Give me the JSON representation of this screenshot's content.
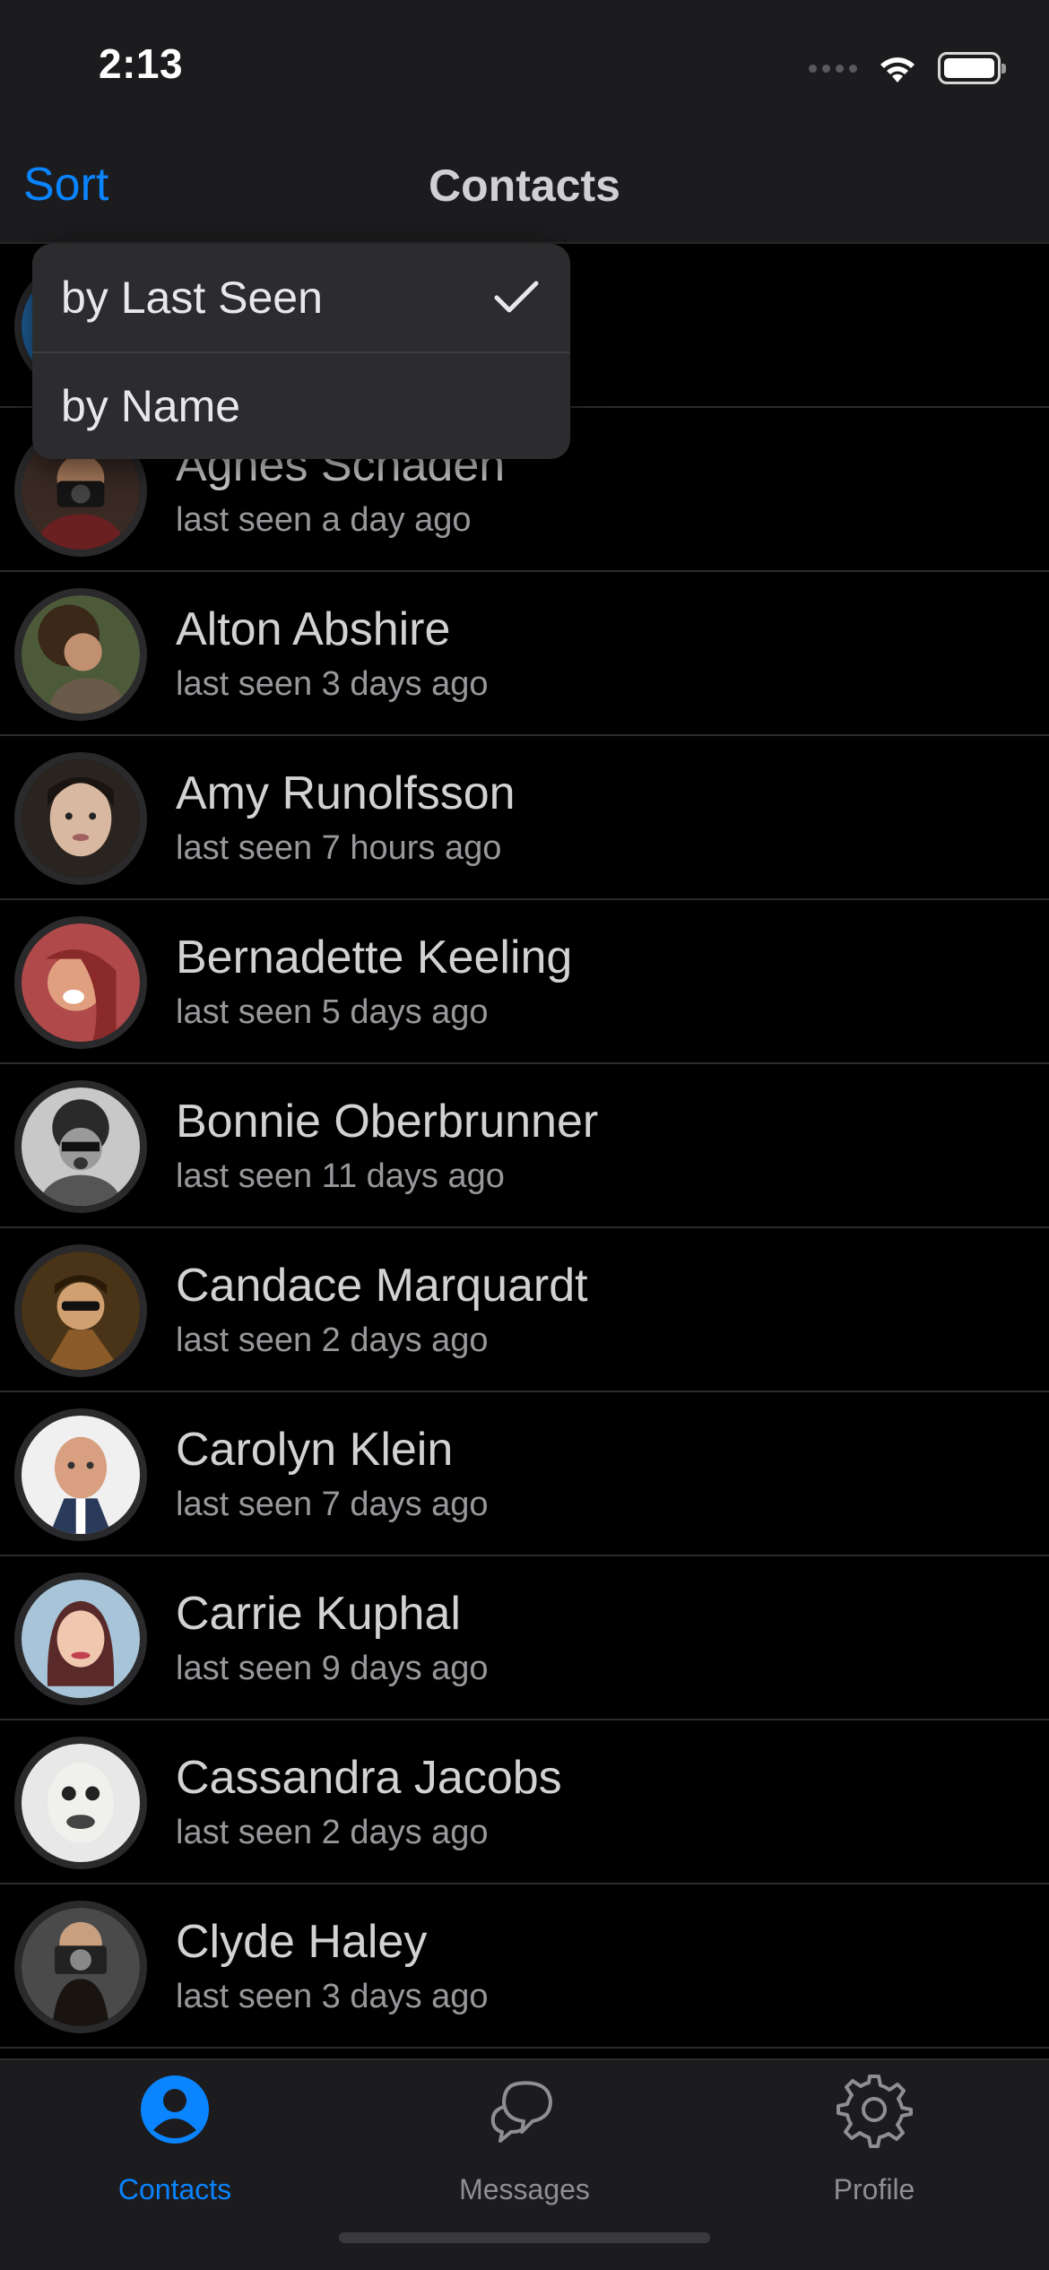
{
  "status_bar": {
    "time": "2:13"
  },
  "nav": {
    "sort_label": "Sort",
    "title": "Contacts"
  },
  "sort_menu": {
    "items": [
      {
        "label": "by Last Seen",
        "selected": true
      },
      {
        "label": "by Name",
        "selected": false
      }
    ]
  },
  "contacts": [
    {
      "name": "",
      "last_seen": "",
      "avatar_color": "#1f5f9a"
    },
    {
      "name": "Agnes Schaden",
      "last_seen": "last seen a day ago",
      "avatar_color": "#3a2a24"
    },
    {
      "name": "Alton Abshire",
      "last_seen": "last seen 3 days ago",
      "avatar_color": "#4c3a2a"
    },
    {
      "name": "Amy Runolfsson",
      "last_seen": "last seen 7 hours ago",
      "avatar_color": "#5a4638"
    },
    {
      "name": "Bernadette Keeling",
      "last_seen": "last seen 5 days ago",
      "avatar_color": "#b04a4a"
    },
    {
      "name": "Bonnie Oberbrunner",
      "last_seen": "last seen 11 days ago",
      "avatar_color": "#7a7a7a"
    },
    {
      "name": "Candace Marquardt",
      "last_seen": "last seen 2 days ago",
      "avatar_color": "#4a3418"
    },
    {
      "name": "Carolyn Klein",
      "last_seen": "last seen 7 days ago",
      "avatar_color": "#c89878"
    },
    {
      "name": "Carrie Kuphal",
      "last_seen": "last seen 9 days ago",
      "avatar_color": "#a8c4d8"
    },
    {
      "name": "Cassandra Jacobs",
      "last_seen": "last seen 2 days ago",
      "avatar_color": "#d8d8d8"
    },
    {
      "name": "Clyde Haley",
      "last_seen": "last seen 3 days ago",
      "avatar_color": "#6a6a6a"
    }
  ],
  "tabbar": {
    "tabs": [
      {
        "label": "Contacts",
        "icon": "person-circle-icon",
        "active": true
      },
      {
        "label": "Messages",
        "icon": "chat-bubbles-icon",
        "active": false
      },
      {
        "label": "Profile",
        "icon": "gear-icon",
        "active": false
      }
    ]
  },
  "colors": {
    "accent": "#0a84ff",
    "background": "#000000",
    "bar": "#1c1c1e"
  }
}
